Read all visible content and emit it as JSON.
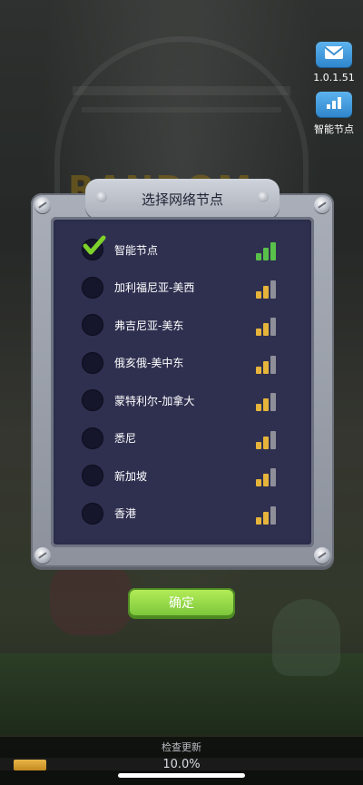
{
  "version": "1.0.1.51",
  "side": {
    "smart_node_label": "智能节点"
  },
  "dialog": {
    "title": "选择网络节点",
    "nodes": [
      {
        "label": "智能节点",
        "selected": true,
        "signal_level": 3,
        "signal_color": "green"
      },
      {
        "label": "加利福尼亚-美西",
        "selected": false,
        "signal_level": 2,
        "signal_color": "gold"
      },
      {
        "label": "弗吉尼亚-美东",
        "selected": false,
        "signal_level": 2,
        "signal_color": "gold"
      },
      {
        "label": "俄亥俄-美中东",
        "selected": false,
        "signal_level": 2,
        "signal_color": "gold"
      },
      {
        "label": "蒙特利尔-加拿大",
        "selected": false,
        "signal_level": 2,
        "signal_color": "gold"
      },
      {
        "label": "悉尼",
        "selected": false,
        "signal_level": 2,
        "signal_color": "gold"
      },
      {
        "label": "新加坡",
        "selected": false,
        "signal_level": 2,
        "signal_color": "gold"
      },
      {
        "label": "香港",
        "selected": false,
        "signal_level": 2,
        "signal_color": "gold"
      }
    ],
    "confirm_label": "确定"
  },
  "bottom": {
    "update_text": "检查更新",
    "progress_text": "10.0%",
    "progress_fraction": 0.1
  },
  "colors": {
    "green": "#59c04a",
    "gold": "#e6b43a",
    "gray": "#8e8f99",
    "check": "#7ed12a"
  }
}
